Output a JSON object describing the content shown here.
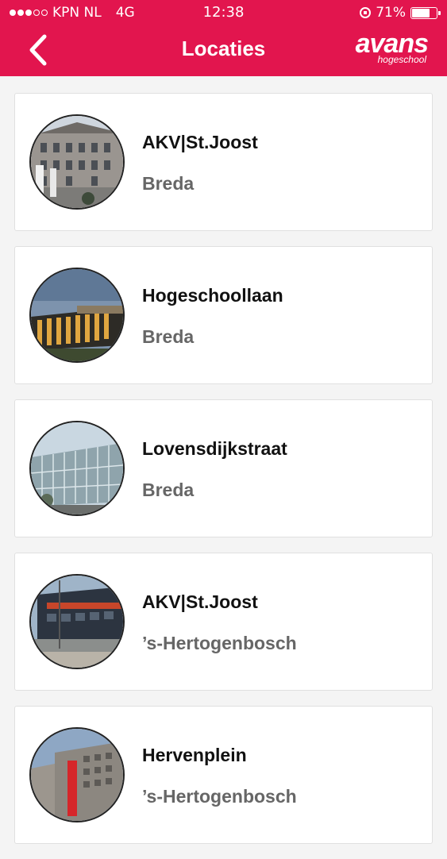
{
  "status_bar": {
    "carrier": "KPN NL",
    "network": "4G",
    "time": "12:38",
    "battery": "71%"
  },
  "header": {
    "title": "Locaties",
    "logo_word": "avans",
    "logo_sub": "hogeschool"
  },
  "locations": [
    {
      "name": "AKV|St.Joost",
      "city": "Breda",
      "image_icon": "building-photo"
    },
    {
      "name": "Hogeschoollaan",
      "city": "Breda",
      "image_icon": "building-photo"
    },
    {
      "name": "Lovensdijkstraat",
      "city": "Breda",
      "image_icon": "building-photo"
    },
    {
      "name": "AKV|St.Joost",
      "city": "’s-Hertogenbosch",
      "image_icon": "building-photo"
    },
    {
      "name": "Hervenplein",
      "city": "’s-Hertogenbosch",
      "image_icon": "building-photo"
    }
  ],
  "colors": {
    "brand": "#e2154e"
  }
}
